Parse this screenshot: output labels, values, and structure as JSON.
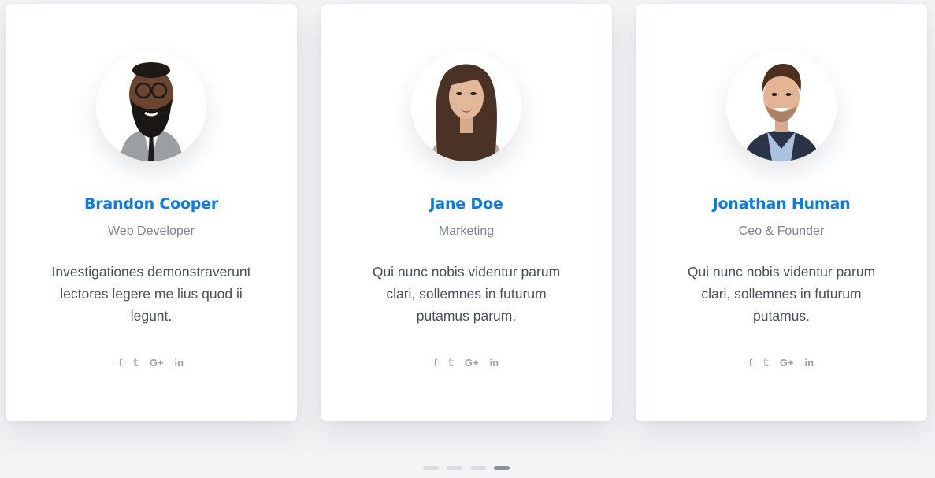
{
  "team": [
    {
      "name": "Brandon Cooper",
      "role": "Web Developer",
      "bio": "Investigationes demonstraverunt lectores legere me lius quod ii legunt.",
      "social": {
        "facebook": "f",
        "twitter": "𝕥",
        "google_plus": "G+",
        "linkedin": "in"
      }
    },
    {
      "name": "Jane Doe",
      "role": "Marketing",
      "bio": "Qui nunc nobis videntur parum clari, sollemnes in futurum putamus parum.",
      "social": {
        "facebook": "f",
        "twitter": "𝕥",
        "google_plus": "G+",
        "linkedin": "in"
      }
    },
    {
      "name": "Jonathan Human",
      "role": "Ceo & Founder",
      "bio": "Qui nunc nobis videntur parum clari, sollemnes in futurum putamus.",
      "social": {
        "facebook": "f",
        "twitter": "𝕥",
        "google_plus": "G+",
        "linkedin": "in"
      }
    }
  ],
  "pagination": {
    "total": 4,
    "active_index": 3
  },
  "colors": {
    "name": "#0a7ce6",
    "role": "#7b8595",
    "bio": "#4b4f57",
    "icon": "#9aa1ab"
  }
}
